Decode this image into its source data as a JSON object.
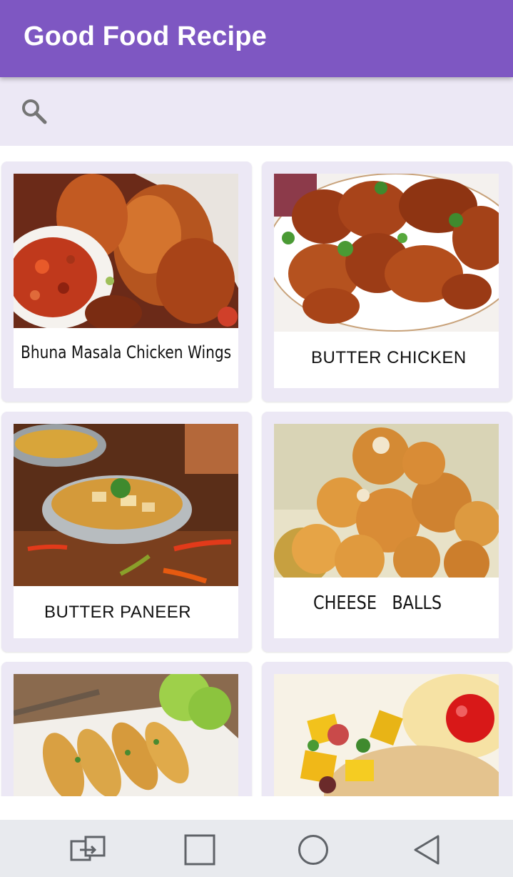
{
  "app_bar": {
    "title": "Good Food Recipe",
    "color": "#7e57c2"
  },
  "search": {
    "icon": "search-icon",
    "placeholder": ""
  },
  "recipes": [
    {
      "label": "Bhuna Masala Chicken Wings",
      "image": "chicken wings in masala with chili dip"
    },
    {
      "label": "BUTTER CHICKEN",
      "image": "fried chicken pieces with coriander"
    },
    {
      "label": "BUTTER PANEER",
      "image": "paneer curry in kadai with chilies"
    },
    {
      "label": "CHEESE   BALLS",
      "image": "golden fried cheese balls"
    },
    {
      "label": "",
      "image": "stuffed chilies with lime"
    },
    {
      "label": "",
      "image": "mango salsa with cherry tomato"
    }
  ],
  "nav": [
    {
      "icon": "recent-apps-switch-icon"
    },
    {
      "icon": "square-icon"
    },
    {
      "icon": "circle-home-icon"
    },
    {
      "icon": "triangle-back-icon"
    }
  ]
}
